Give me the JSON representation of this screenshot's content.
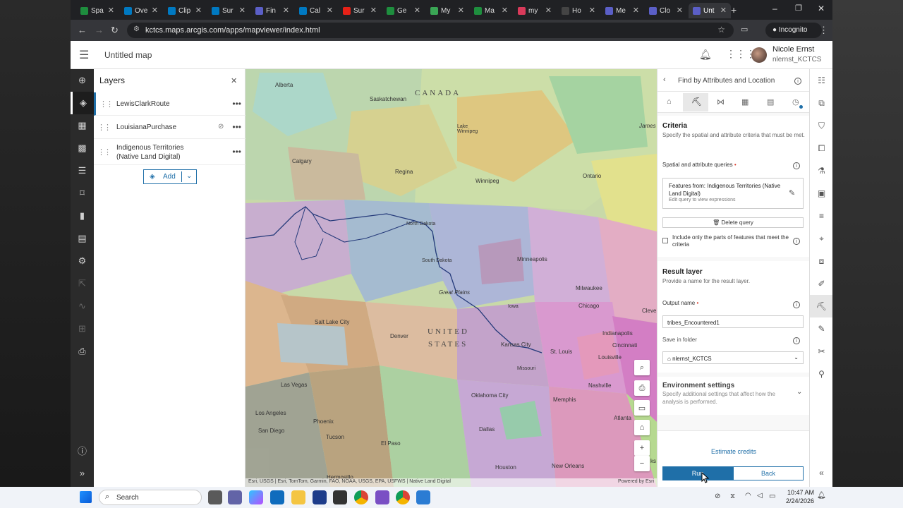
{
  "browser": {
    "tabs": [
      "Spa",
      "Ove",
      "Clip",
      "Sur",
      "Fin",
      "Cal",
      "Sur",
      "Ge",
      "My",
      "Ma",
      "my",
      "Ho",
      "Me",
      "Clo",
      "Unt"
    ],
    "url": "kctcs.maps.arcgis.com/apps/mapviewer/index.html",
    "incognito_label": "Incognito"
  },
  "header": {
    "title": "Untitled map",
    "user_name": "Nicole Ernst",
    "user_id": "nlernst_KCTCS"
  },
  "layers_panel": {
    "title": "Layers",
    "layers": [
      {
        "name": "LewisClarkRoute"
      },
      {
        "name": "LouisianaPurchase"
      },
      {
        "name": "Indigenous Territories\n(Native Land Digital)"
      }
    ],
    "add_label": "Add"
  },
  "map": {
    "labels": {
      "canada": "CANADA",
      "united": "UNITED",
      "states": "STATES",
      "alberta": "Alberta",
      "saskatchewan": "Saskatchewan",
      "calgary": "Calgary",
      "regina": "Regina",
      "winnipeg": "Winnipeg",
      "ontario": "Ontario",
      "lake_winnipeg": "Lake\nWinnipeg",
      "james": "James",
      "north_dakota": "North Dakota",
      "south_dakota": "South Dakota",
      "minneapolis": "Minneapolis",
      "great_plains": "Great Plains",
      "milwaukee": "Milwaukee",
      "chicago": "Chicago",
      "iowa": "Iowa",
      "cleve": "Cleve",
      "salt_lake": "Salt Lake City",
      "denver": "Denver",
      "kansas_city": "Kansas City",
      "st_louis": "St. Louis",
      "missouri": "Missouri",
      "indianapolis": "Indianapolis",
      "cincinnati": "Cincinnati",
      "louisville": "Louisville",
      "las_vegas": "Las Vegas",
      "los_angeles": "Los Angeles",
      "phoenix": "Phoenix",
      "san_diego": "San Diego",
      "tucson": "Tucson",
      "el_paso": "El Paso",
      "dallas": "Dallas",
      "oklahoma_city": "Oklahoma City",
      "memphis": "Memphis",
      "nashville": "Nashville",
      "atlanta": "Atlanta",
      "houston": "Houston",
      "new_orleans": "New Orleans",
      "hermosillo": "Hermosillo",
      "ks": "ks"
    },
    "attribution": "Esri, USGS | Esri, TomTom, Garmin, FAO, NOAA, USGS, EPA, USFWS | Native Land Digital",
    "powered_by": "Powered by Esri"
  },
  "tool_panel": {
    "title": "Find by Attributes and Location",
    "criteria": {
      "title": "Criteria",
      "desc": "Specify the spatial and attribute criteria that must be met.",
      "queries_label": "Spatial and attribute queries",
      "query_title": "Features from: Indigenous Territories (Native Land Digital)",
      "query_hint": "Edit query to view expressions",
      "delete_label": "Delete query",
      "include_label": "Include only the parts of features that meet the criteria"
    },
    "result": {
      "title": "Result layer",
      "desc": "Provide a name for the result layer.",
      "output_label": "Output name",
      "output_value": "tribes_Encountered1",
      "folder_label": "Save in folder",
      "folder_value": "nlernst_KCTCS"
    },
    "env": {
      "title": "Environment settings",
      "desc": "Specify additional settings that affect how the analysis is performed."
    },
    "estimate_label": "Estimate credits",
    "run_label": "Run",
    "back_label": "Back"
  },
  "taskbar": {
    "search_placeholder": "Search",
    "time": "10:47 AM",
    "date": "2/24/2026"
  },
  "colors": {
    "accent": "#1f6fa8",
    "route": "#253a7a"
  }
}
